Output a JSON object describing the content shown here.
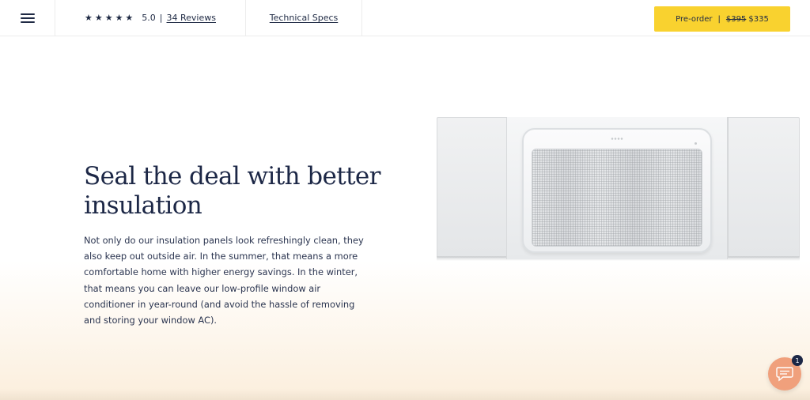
{
  "header": {
    "menu_icon": "hamburger-menu-icon",
    "stars": "★★★★★",
    "rating": "5.0",
    "separator": "|",
    "reviews_label": "34 Reviews",
    "specs_label": "Technical Specs",
    "preorder": {
      "label": "Pre-order",
      "separator": "|",
      "old_price": "$395",
      "price": "$335",
      "color": "#f9d22f"
    }
  },
  "hero": {
    "title": "Seal the deal with better insulation",
    "body": "Not only do our insulation panels look refreshingly clean, they also keep out outside air. In the summer, that means a more comfortable home with higher energy savings. In the winter, that means you can leave our low-profile window air conditioner in year-round (and avoid the hassle of removing and storing your window AC).",
    "image": "window-air-conditioner-with-insulation-panels"
  },
  "chat": {
    "icon": "chat-bubble-icon",
    "badge_count": "1",
    "color": "#f0a07c"
  }
}
